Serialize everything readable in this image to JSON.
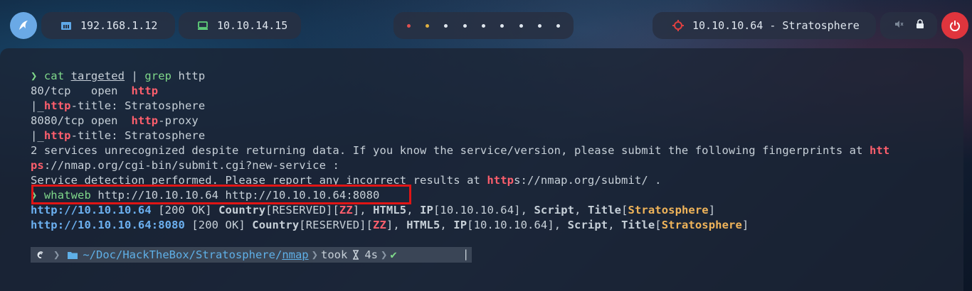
{
  "topbar": {
    "host_ip": "192.168.1.12",
    "vpn_ip": "10.10.14.15",
    "target": "10.10.10.64 - Stratosphere",
    "workspaces": [
      "active",
      "warn",
      "dot",
      "dot",
      "dot",
      "dot",
      "dot",
      "dot",
      "dot"
    ],
    "icons": {
      "logo": "parrot-logo-icon",
      "host": "network-icon",
      "vpn": "monitor-icon",
      "target": "crosshair-icon",
      "mute": "speaker-muted-icon",
      "lock": "lock-icon",
      "power": "power-icon"
    },
    "colors": {
      "logo": "#6aa9e6",
      "power": "#e0353d",
      "target_icon": "#e04040"
    }
  },
  "terminal": {
    "prompt_char": "❯",
    "line1": {
      "cmd": "cat",
      "file": "targeted",
      "pipe": " | ",
      "cmd2": "grep",
      "arg": " http"
    },
    "line2": {
      "a": "80/tcp   open  ",
      "b": "http"
    },
    "line3": {
      "a": "|_",
      "b": "http",
      "c": "-title: Stratosphere"
    },
    "line4": {
      "a": "8080/tcp open  ",
      "b": "http",
      "c": "-proxy"
    },
    "line5": {
      "a": "|_",
      "b": "http",
      "c": "-title: Stratosphere"
    },
    "line6": {
      "a": "2 services unrecognized despite returning data. If you know the service/version, please submit the following fingerprints at ",
      "b": "htt"
    },
    "line7": {
      "a": "ps",
      "b": "://nmap.org/cgi-bin/submit.cgi?new-service :"
    },
    "line8": {
      "a": "Service detection performed. Please report any incorrect results at ",
      "b": "http",
      "c": "s://nmap.org/submit/ ."
    },
    "line9": {
      "cmd": "whatweb",
      "args": " http://10.10.10.64 http://10.10.10.64:8080"
    },
    "line10": {
      "url": "http://10.10.10.64",
      "status": " [200 OK] ",
      "country": "Country",
      "reserved": "[RESERVED][",
      "zz": "ZZ",
      "rest1": "], ",
      "html5": "HTML5",
      "comma1": ", ",
      "ip": "IP",
      "ipval": "[10.10.10.64], ",
      "script": "Script",
      "comma2": ", ",
      "title": "Title",
      "lb": "[",
      "titleval": "Stratosphere",
      "rb": "]"
    },
    "line11": {
      "url": "http://10.10.10.64:8080",
      "status": " [200 OK] ",
      "country": "Country",
      "reserved": "[RESERVED][",
      "zz": "ZZ",
      "rest1": "], ",
      "html5": "HTML5",
      "comma1": ", ",
      "ip": "IP",
      "ipval": "[10.10.10.64], ",
      "script": "Script",
      "comma2": ", ",
      "title": "Title",
      "lb": "[",
      "titleval": "Stratosphere",
      "rb": "]"
    },
    "prompt": {
      "os_icon": "debian-icon",
      "folder_icon": "folder-icon",
      "path_home": "~/Doc/HackTheBox/Stratosphere/",
      "path_dir": "nmap",
      "took": "took",
      "hourglass_icon": "hourglass-icon",
      "duration": "4s",
      "check": "✔",
      "cursor": "|"
    }
  }
}
